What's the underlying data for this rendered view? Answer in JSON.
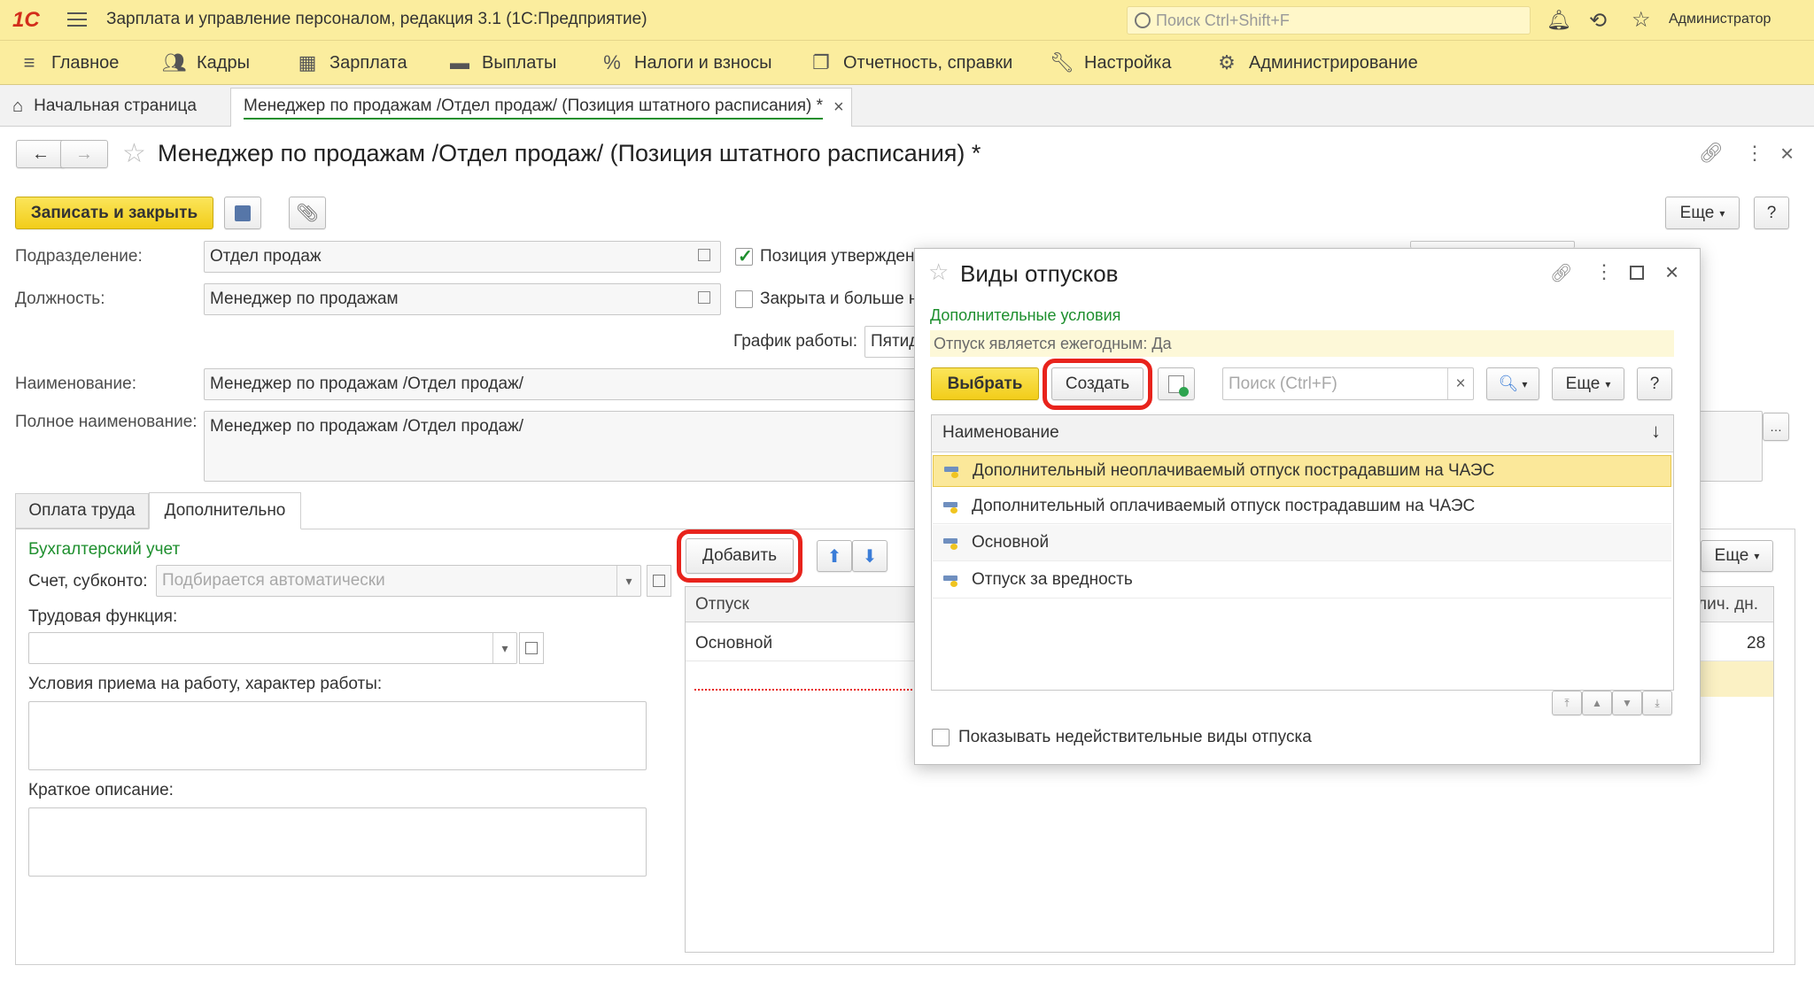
{
  "app": {
    "title": "Зарплата и управление персоналом, редакция 3.1  (1С:Предприятие)",
    "logo": "1С",
    "search_placeholder": "Поиск Ctrl+Shift+F",
    "user": "Администратор"
  },
  "menu": [
    {
      "label": "Главное",
      "icon": "hamburger-icon"
    },
    {
      "label": "Кадры",
      "icon": "people-icon"
    },
    {
      "label": "Зарплата",
      "icon": "calculator-icon"
    },
    {
      "label": "Выплаты",
      "icon": "wallet-icon"
    },
    {
      "label": "Налоги и взносы",
      "icon": "percent-icon"
    },
    {
      "label": "Отчетность, справки",
      "icon": "report-icon"
    },
    {
      "label": "Настройка",
      "icon": "wrench-icon"
    },
    {
      "label": "Администрирование",
      "icon": "gear-icon"
    }
  ],
  "tabs": {
    "home": "Начальная страница",
    "active": "Менеджер по продажам /Отдел продаж/ (Позиция штатного расписания) *"
  },
  "form": {
    "title": "Менеджер по продажам /Отдел продаж/ (Позиция штатного расписания) *",
    "save_close": "Записать и закрыть",
    "more": "Еще",
    "help": "?",
    "division_label": "Подразделение:",
    "division_value": "Отдел продаж",
    "position_label": "Должность:",
    "position_value": "Менеджер по продажам",
    "approved_label": "Позиция утвержден",
    "closed_label": "Закрыта и больше н",
    "schedule_label": "График работы:",
    "schedule_value": "Пятид",
    "name_label": "Наименование:",
    "name_value": "Менеджер по продажам /Отдел продаж/",
    "fullname_label": "Полное наименование:",
    "fullname_value": "Менеджер по продажам /Отдел продаж/",
    "tab_pay": "Оплата труда",
    "tab_extra": "Дополнительно",
    "accounting_title": "Бухгалтерский учет",
    "account_label": "Счет, субконто:",
    "account_placeholder": "Подбирается автоматически",
    "labor_func_label": "Трудовая функция:",
    "conditions_label": "Условия приема на работу, характер работы:",
    "short_desc_label": "Краткое описание:",
    "add_button": "Добавить",
    "leave_more": "Еще",
    "leave_col": "Отпуск",
    "leave_days_col": "лич. дн.",
    "leave_row_name": "Основной",
    "leave_row_days": "28"
  },
  "dialog": {
    "title": "Виды отпусков",
    "conditions_title": "Дополнительные условия",
    "filter_text": "Отпуск является ежегодным: Да",
    "select_button": "Выбрать",
    "create_button": "Создать",
    "search_placeholder": "Поиск (Ctrl+F)",
    "clear": "×",
    "more": "Еще",
    "help": "?",
    "column_name": "Наименование",
    "sort_icon": "↓",
    "rows": [
      "Дополнительный неоплачиваемый отпуск пострадавшим на ЧАЭС",
      "Дополнительный оплачиваемый отпуск пострадавшим на ЧАЭС",
      "Основной",
      "Отпуск за вредность"
    ],
    "show_invalid": "Показывать недействительные виды отпуска"
  },
  "colors": {
    "header_bg": "#fbed9e",
    "accent_yellow": "#f2cd1a",
    "selected_row": "#fbe89a",
    "green_title": "#1e8f2e",
    "highlight_red": "#e8231c"
  }
}
